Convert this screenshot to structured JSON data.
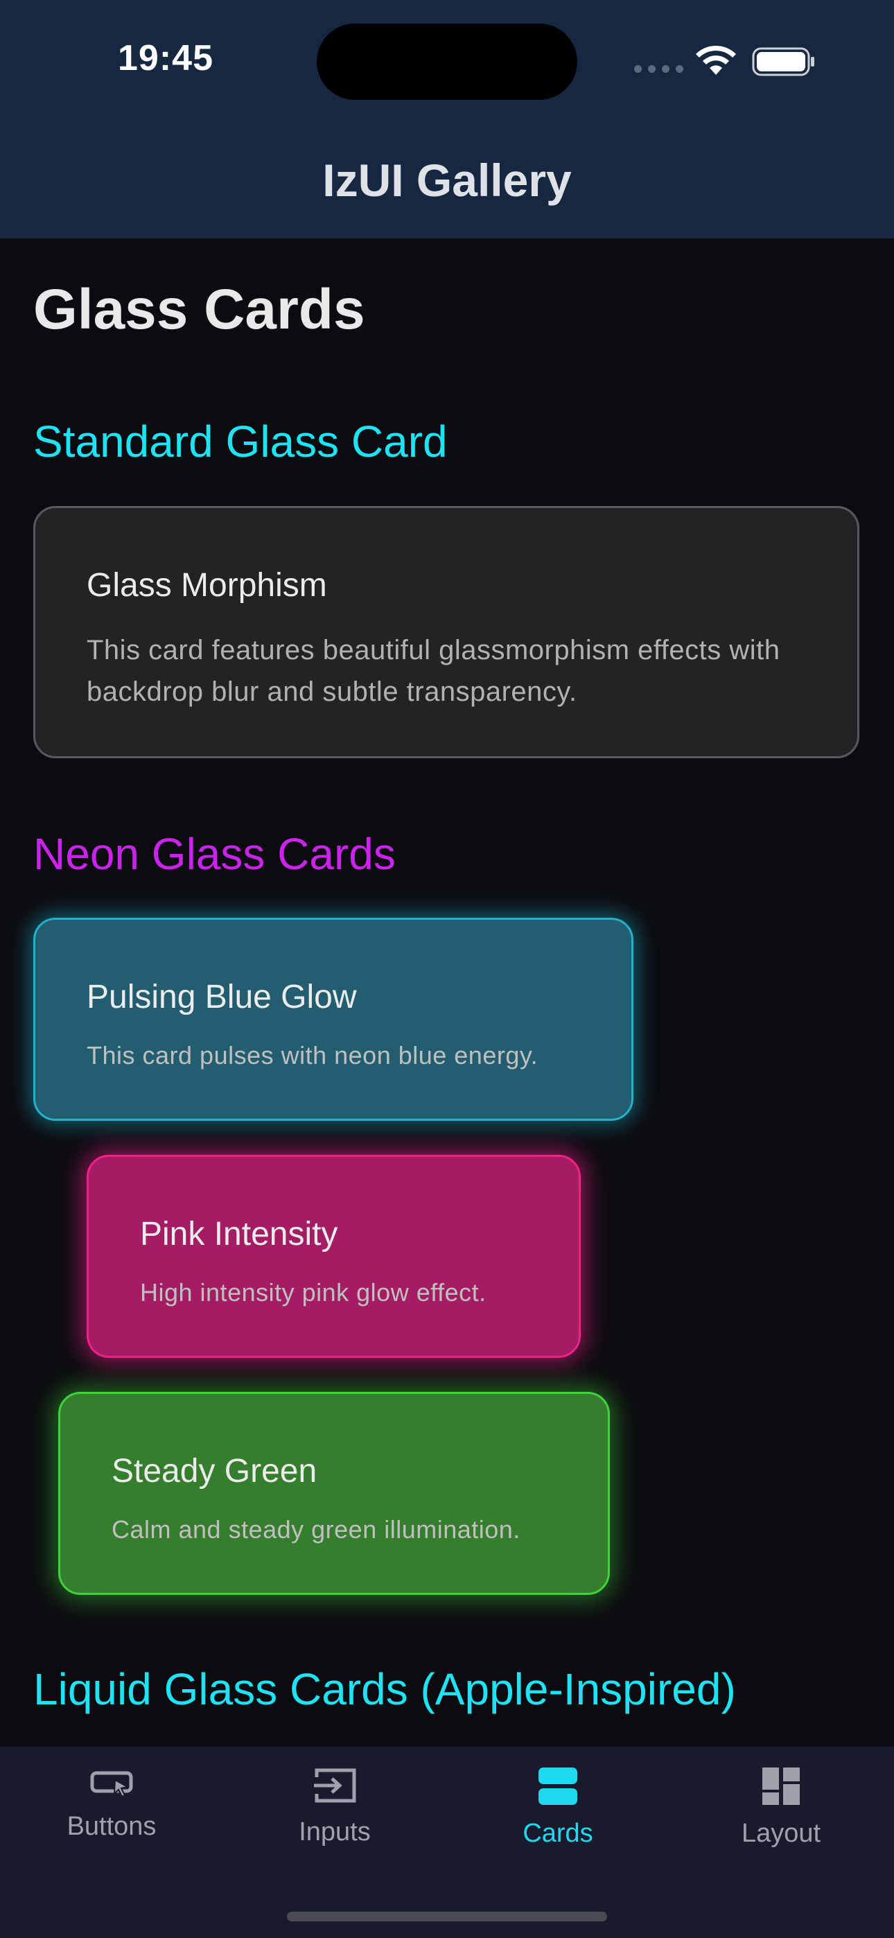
{
  "status_bar": {
    "time": "19:45",
    "icons": [
      "cellular-signal-icon",
      "wifi-icon",
      "battery-icon"
    ]
  },
  "header": {
    "title": "IzUI Gallery"
  },
  "page": {
    "title": "Glass Cards"
  },
  "sections": {
    "standard": {
      "title": "Standard Glass Card",
      "card": {
        "title": "Glass Morphism",
        "description": "This card features beautiful glassmorphism effects with backdrop blur and subtle transparency."
      }
    },
    "neon": {
      "title": "Neon Glass Cards",
      "cards": [
        {
          "title": "Pulsing Blue Glow",
          "description": "This card pulses with neon blue energy.",
          "color": "#22b2cc"
        },
        {
          "title": "Pink Intensity",
          "description": "High intensity pink glow effect.",
          "color": "#f0208a"
        },
        {
          "title": "Steady Green",
          "description": "Calm and steady green illumination.",
          "color": "#3fd23a"
        }
      ]
    },
    "liquid": {
      "title": "Liquid Glass Cards (Apple-Inspired)"
    }
  },
  "tabbar": {
    "active": "Cards",
    "active_color": "#1ed9f0",
    "tabs": [
      {
        "label": "Buttons",
        "icon": "button-cursor-icon"
      },
      {
        "label": "Inputs",
        "icon": "input-arrow-icon"
      },
      {
        "label": "Cards",
        "icon": "cards-stack-icon"
      },
      {
        "label": "Layout",
        "icon": "layout-grid-icon"
      }
    ]
  },
  "colors": {
    "header_bg": "#162841",
    "background": "#0c0c10",
    "accent_cyan": "#1ee3f5",
    "accent_purple": "#cc22ee"
  }
}
